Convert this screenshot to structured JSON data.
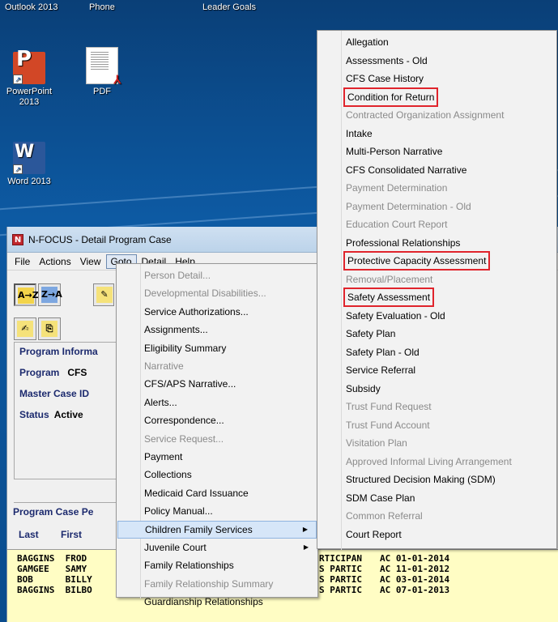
{
  "desktop": {
    "taskbar": [
      "Outlook 2013",
      "Phone",
      "Leader Goals"
    ],
    "icons": {
      "powerpoint": "PowerPoint 2013",
      "pdf": "PDF",
      "word": "Word 2013"
    }
  },
  "app": {
    "title": "N-FOCUS - Detail Program Case",
    "icon_letter": "N",
    "menu": [
      "File",
      "Actions",
      "View",
      "Goto",
      "Detail",
      "Help"
    ],
    "toolbar": {
      "sort_az": "A→Z",
      "sort_za": "Z→A"
    },
    "panel": {
      "heading": "Program Informa",
      "program_label": "Program",
      "program_value": "CFS",
      "master_case_label": "Master Case ID",
      "status_label": "Status",
      "status_value": "Active"
    },
    "pcp": {
      "heading": "Program Case Pe",
      "col_last": "Last",
      "col_first": "First"
    },
    "people": [
      {
        "last": "BAGGINS",
        "first": "FROD",
        "role": "RTICIPAN",
        "date": "AC 01-01-2014"
      },
      {
        "last": "GAMGEE",
        "first": "SAMY",
        "role": "S PARTIC",
        "date": "AC 11-01-2012"
      },
      {
        "last": "BOB",
        "first": "BILLY",
        "role": "S PARTIC",
        "date": "AC 03-01-2014"
      },
      {
        "last": "BAGGINS",
        "first": "BILBO",
        "role": "S PARTIC",
        "date": "AC 07-01-2013"
      }
    ]
  },
  "goto_menu": [
    {
      "label": "Person Detail...",
      "enabled": false
    },
    {
      "label": "Developmental Disabilities...",
      "enabled": false
    },
    {
      "label": "Service Authorizations...",
      "enabled": true
    },
    {
      "label": "Assignments...",
      "enabled": true
    },
    {
      "label": "Eligibility Summary",
      "enabled": true
    },
    {
      "label": "Narrative",
      "enabled": false
    },
    {
      "label": "CFS/APS Narrative...",
      "enabled": true
    },
    {
      "label": "Alerts...",
      "enabled": true
    },
    {
      "label": "Correspondence...",
      "enabled": true
    },
    {
      "label": "Service Request...",
      "enabled": false
    },
    {
      "label": "Payment",
      "enabled": true
    },
    {
      "label": "Collections",
      "enabled": true
    },
    {
      "label": "Medicaid Card Issuance",
      "enabled": true
    },
    {
      "label": "Policy Manual...",
      "enabled": true
    },
    {
      "label": "Children Family Services",
      "enabled": true,
      "submenu": true,
      "highlighted": true
    },
    {
      "label": "Juvenile Court",
      "enabled": true,
      "submenu": true
    },
    {
      "label": "Family Relationships",
      "enabled": true
    },
    {
      "label": "Family Relationship Summary",
      "enabled": false
    },
    {
      "label": "Guardianship Relationships",
      "enabled": true
    }
  ],
  "submenu": [
    {
      "label": "Allegation",
      "enabled": true
    },
    {
      "label": "Assessments - Old",
      "enabled": true
    },
    {
      "label": "CFS Case History",
      "enabled": true
    },
    {
      "label": "Condition for Return",
      "enabled": true,
      "boxed": true
    },
    {
      "label": "Contracted Organization Assignment",
      "enabled": false
    },
    {
      "label": "Intake",
      "enabled": true
    },
    {
      "label": "Multi-Person Narrative",
      "enabled": true
    },
    {
      "label": "CFS Consolidated Narrative",
      "enabled": true
    },
    {
      "label": "Payment Determination",
      "enabled": false
    },
    {
      "label": "Payment Determination - Old",
      "enabled": false
    },
    {
      "label": "Education Court Report",
      "enabled": false
    },
    {
      "label": "Professional Relationships",
      "enabled": true
    },
    {
      "label": "Protective Capacity Assessment",
      "enabled": true,
      "boxed": true
    },
    {
      "label": "Removal/Placement",
      "enabled": false
    },
    {
      "label": "Safety Assessment",
      "enabled": true,
      "boxed": true
    },
    {
      "label": "Safety Evaluation - Old",
      "enabled": true
    },
    {
      "label": "Safety Plan",
      "enabled": true
    },
    {
      "label": "Safety Plan - Old",
      "enabled": true
    },
    {
      "label": "Service Referral",
      "enabled": true
    },
    {
      "label": "Subsidy",
      "enabled": true
    },
    {
      "label": "Trust Fund Request",
      "enabled": false
    },
    {
      "label": "Trust Fund Account",
      "enabled": false
    },
    {
      "label": "Visitation Plan",
      "enabled": false
    },
    {
      "label": "Approved Informal Living Arrangement",
      "enabled": false
    },
    {
      "label": "Structured Decision Making (SDM)",
      "enabled": true
    },
    {
      "label": "SDM Case Plan",
      "enabled": true
    },
    {
      "label": "Common Referral",
      "enabled": false
    },
    {
      "label": "Court Report",
      "enabled": true
    }
  ]
}
